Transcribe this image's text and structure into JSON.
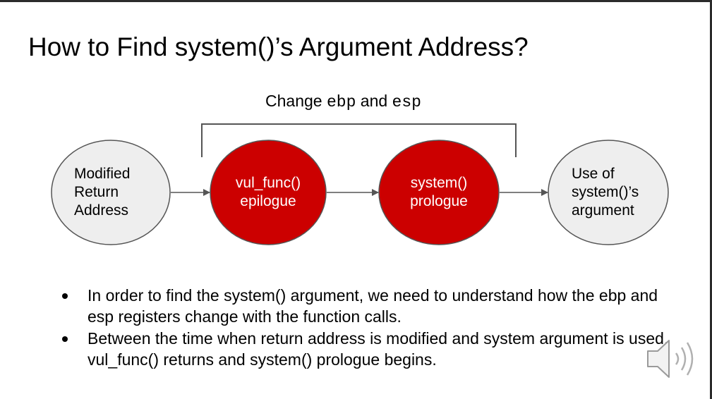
{
  "slide": {
    "title": "How to Find system()’s Argument Address?"
  },
  "bracket": {
    "prefix": "Change ",
    "reg1": "ebp",
    "middle": " and ",
    "reg2": "esp"
  },
  "nodes": [
    {
      "lines": [
        "Modified",
        "Return",
        "Address"
      ],
      "style": "light"
    },
    {
      "lines": [
        "vul_func()",
        "epilogue"
      ],
      "style": "highlight"
    },
    {
      "lines": [
        "system()",
        "prologue"
      ],
      "style": "highlight"
    },
    {
      "lines": [
        "Use of",
        "system()’s",
        "argument"
      ],
      "style": "light"
    }
  ],
  "colors": {
    "highlight_fill": "#cc0000",
    "light_fill": "#eeeeee",
    "outline": "#555555"
  },
  "bullets": [
    "In order to find the system() argument, we need to understand how the ebp and esp registers change with the function calls.",
    "Between the time when return address is modified and system argument is used, vul_func() returns and system() prologue begins."
  ],
  "icons": {
    "audio": "speaker-icon"
  }
}
